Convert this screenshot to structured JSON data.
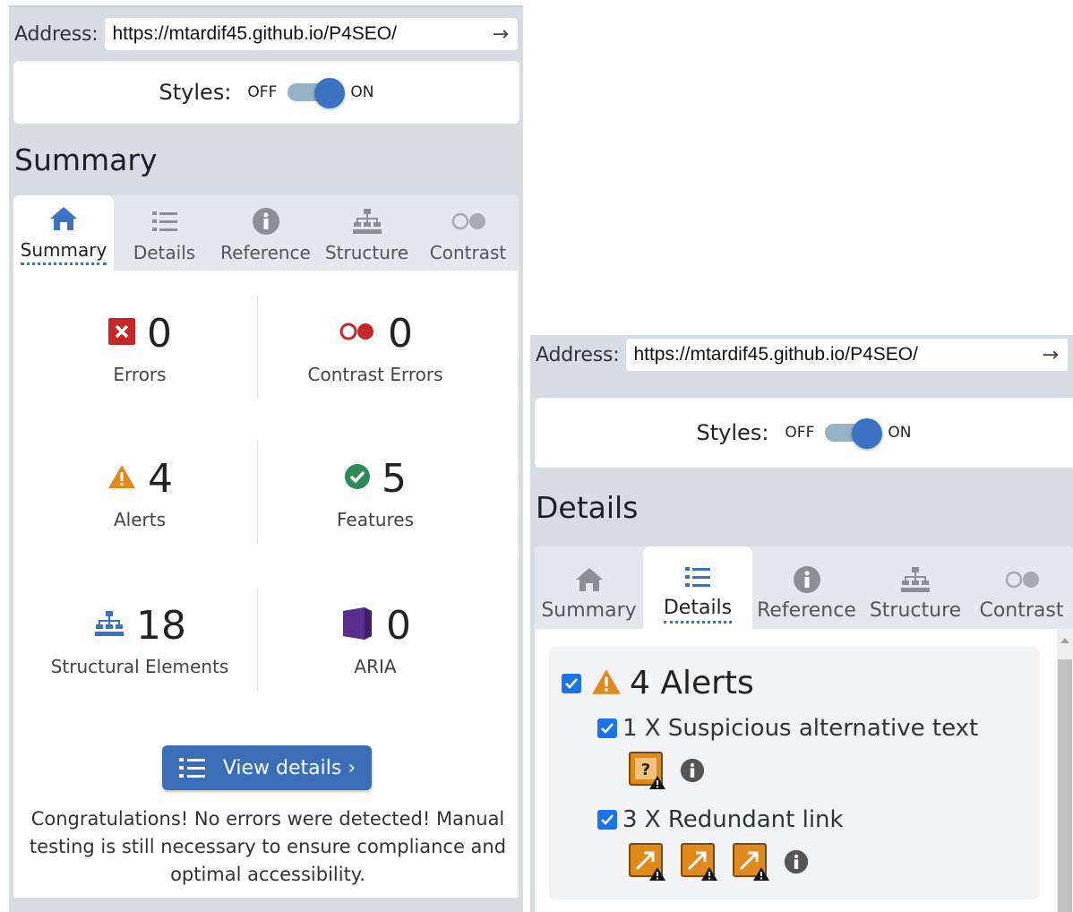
{
  "colors": {
    "panel_bg": "#d5dce4",
    "accent": "#3b73c2",
    "button": "#3a6fb8",
    "error": "#c62828",
    "alert": "#e08a1e",
    "feature": "#2e8b57",
    "aria": "#5b2d8e"
  },
  "left": {
    "address": {
      "label": "Address:",
      "url": "https://mtardif45.github.io/P4SEO/"
    },
    "styles": {
      "label": "Styles:",
      "off": "OFF",
      "on": "ON",
      "state": "on"
    },
    "section_title": "Summary",
    "tabs": [
      {
        "label": "Summary",
        "icon": "home-icon",
        "active": true
      },
      {
        "label": "Details",
        "icon": "list-icon",
        "active": false
      },
      {
        "label": "Reference",
        "icon": "info-icon",
        "active": false
      },
      {
        "label": "Structure",
        "icon": "hierarchy-icon",
        "active": false
      },
      {
        "label": "Contrast",
        "icon": "contrast-icon",
        "active": false
      }
    ],
    "stats": {
      "errors": {
        "value": "0",
        "label": "Errors"
      },
      "contrast_errors": {
        "value": "0",
        "label": "Contrast Errors"
      },
      "alerts": {
        "value": "4",
        "label": "Alerts"
      },
      "features": {
        "value": "5",
        "label": "Features"
      },
      "structural": {
        "value": "18",
        "label": "Structural Elements"
      },
      "aria": {
        "value": "0",
        "label": "ARIA"
      }
    },
    "view_details_label": "View details ›",
    "congrats_text": "Congratulations! No errors were detected! Manual testing is still necessary to ensure compliance and optimal accessibility."
  },
  "right": {
    "address": {
      "label": "Address:",
      "url": "https://mtardif45.github.io/P4SEO/"
    },
    "styles": {
      "label": "Styles:",
      "off": "OFF",
      "on": "ON",
      "state": "on"
    },
    "section_title": "Details",
    "tabs": [
      {
        "label": "Summary",
        "icon": "home-icon",
        "active": false
      },
      {
        "label": "Details",
        "icon": "list-icon",
        "active": true
      },
      {
        "label": "Reference",
        "icon": "info-icon",
        "active": false
      },
      {
        "label": "Structure",
        "icon": "hierarchy-icon",
        "active": false
      },
      {
        "label": "Contrast",
        "icon": "contrast-icon",
        "active": false
      }
    ],
    "alerts_heading": "4 Alerts",
    "alert_items": [
      {
        "label": "1 X Suspicious alternative text",
        "checked": true,
        "icon_count": 1
      },
      {
        "label": "3 X Redundant link",
        "checked": true,
        "icon_count": 3
      }
    ]
  }
}
